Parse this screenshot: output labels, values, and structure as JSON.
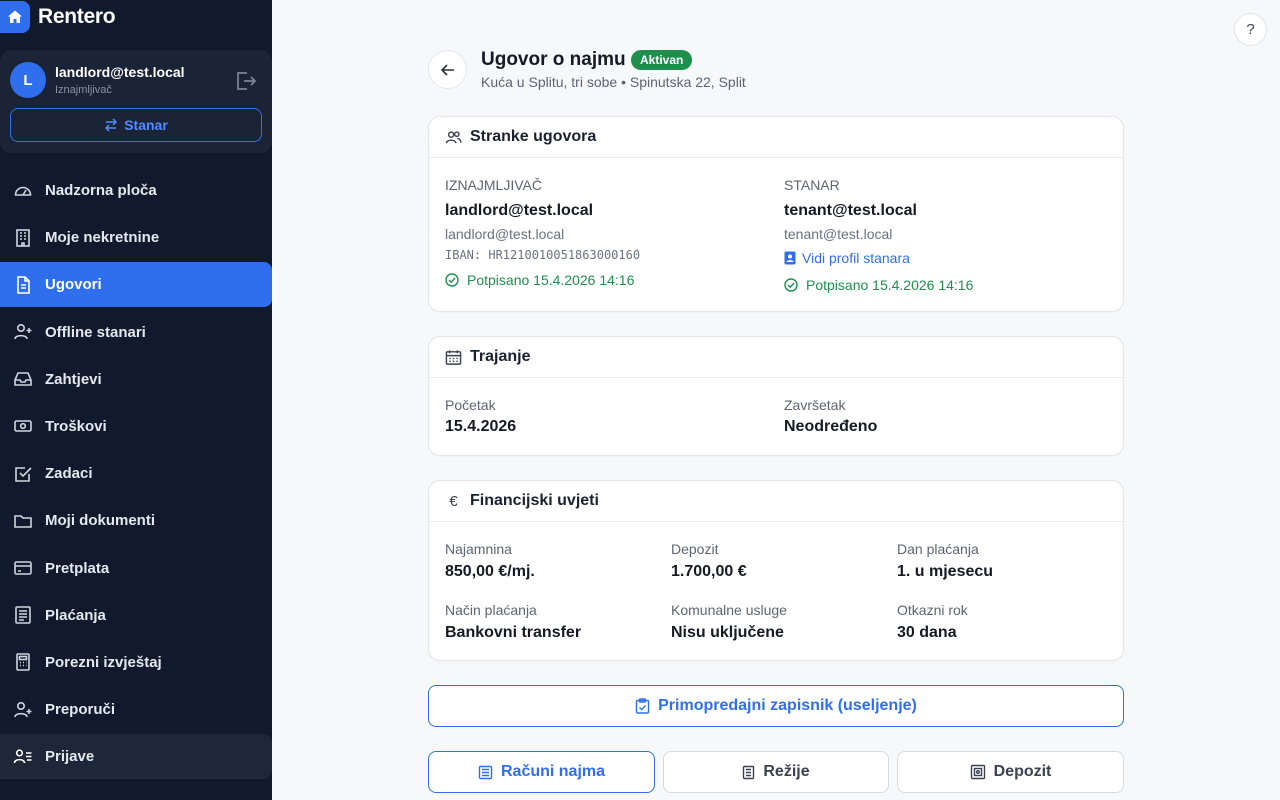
{
  "app": {
    "name": "Rentero"
  },
  "user": {
    "initial": "L",
    "email": "landlord@test.local",
    "role": "Iznajmljivač",
    "switch_label": "Stanar"
  },
  "nav": [
    {
      "label": "Nadzorna ploča",
      "icon": "gauge-icon"
    },
    {
      "label": "Moje nekretnine",
      "icon": "building-icon"
    },
    {
      "label": "Ugovori",
      "icon": "document-icon",
      "active": true
    },
    {
      "label": "Offline stanari",
      "icon": "user-plus-icon"
    },
    {
      "label": "Zahtjevi",
      "icon": "inbox-icon"
    },
    {
      "label": "Troškovi",
      "icon": "money-icon"
    },
    {
      "label": "Zadaci",
      "icon": "checkbox-icon"
    },
    {
      "label": "Moji dokumenti",
      "icon": "folder-icon"
    },
    {
      "label": "Pretplata",
      "icon": "credit-card-icon"
    },
    {
      "label": "Plaćanja",
      "icon": "receipt-icon"
    },
    {
      "label": "Porezni izvještaj",
      "icon": "calculator-icon"
    },
    {
      "label": "Preporuči",
      "icon": "user-add-icon"
    },
    {
      "label": "Prijave",
      "icon": "user-list-icon",
      "hover": true
    }
  ],
  "header": {
    "title": "Ugovor o najmu",
    "status": "Aktivan",
    "subtitle": "Kuća u Splitu, tri sobe • Spinutska 22, Split"
  },
  "parties": {
    "title": "Stranke ugovora",
    "landlord": {
      "heading": "IZNAJMLJIVAČ",
      "name": "landlord@test.local",
      "email": "landlord@test.local",
      "iban": "IBAN: HR1210010051863000160",
      "signed": "Potpisano 15.4.2026 14:16"
    },
    "tenant": {
      "heading": "STANAR",
      "name": "tenant@test.local",
      "email": "tenant@test.local",
      "profile_link": "Vidi profil stanara",
      "signed": "Potpisano 15.4.2026 14:16"
    }
  },
  "duration": {
    "title": "Trajanje",
    "start_label": "Početak",
    "start_value": "15.4.2026",
    "end_label": "Završetak",
    "end_value": "Neodređeno"
  },
  "finance": {
    "title": "Financijski uvjeti",
    "icon_glyph": "€",
    "rent_label": "Najamnina",
    "rent_value": "850,00 €/mj.",
    "deposit_label": "Depozit",
    "deposit_value": "1.700,00 €",
    "payday_label": "Dan plaćanja",
    "payday_value": "1. u mjesecu",
    "method_label": "Način plaćanja",
    "method_value": "Bankovni transfer",
    "utilities_label": "Komunalne usluge",
    "utilities_value": "Nisu uključene",
    "notice_label": "Otkazni rok",
    "notice_value": "30 dana"
  },
  "actions": {
    "handover": "Primopredajni zapisnik (useljenje)",
    "invoices": "Računi najma",
    "utilities": "Režije",
    "deposit": "Depozit"
  },
  "help": {
    "label": "?"
  },
  "colors": {
    "sidebar": "#111a2c",
    "accent": "#2f6fed",
    "success": "#1f8f4e"
  }
}
